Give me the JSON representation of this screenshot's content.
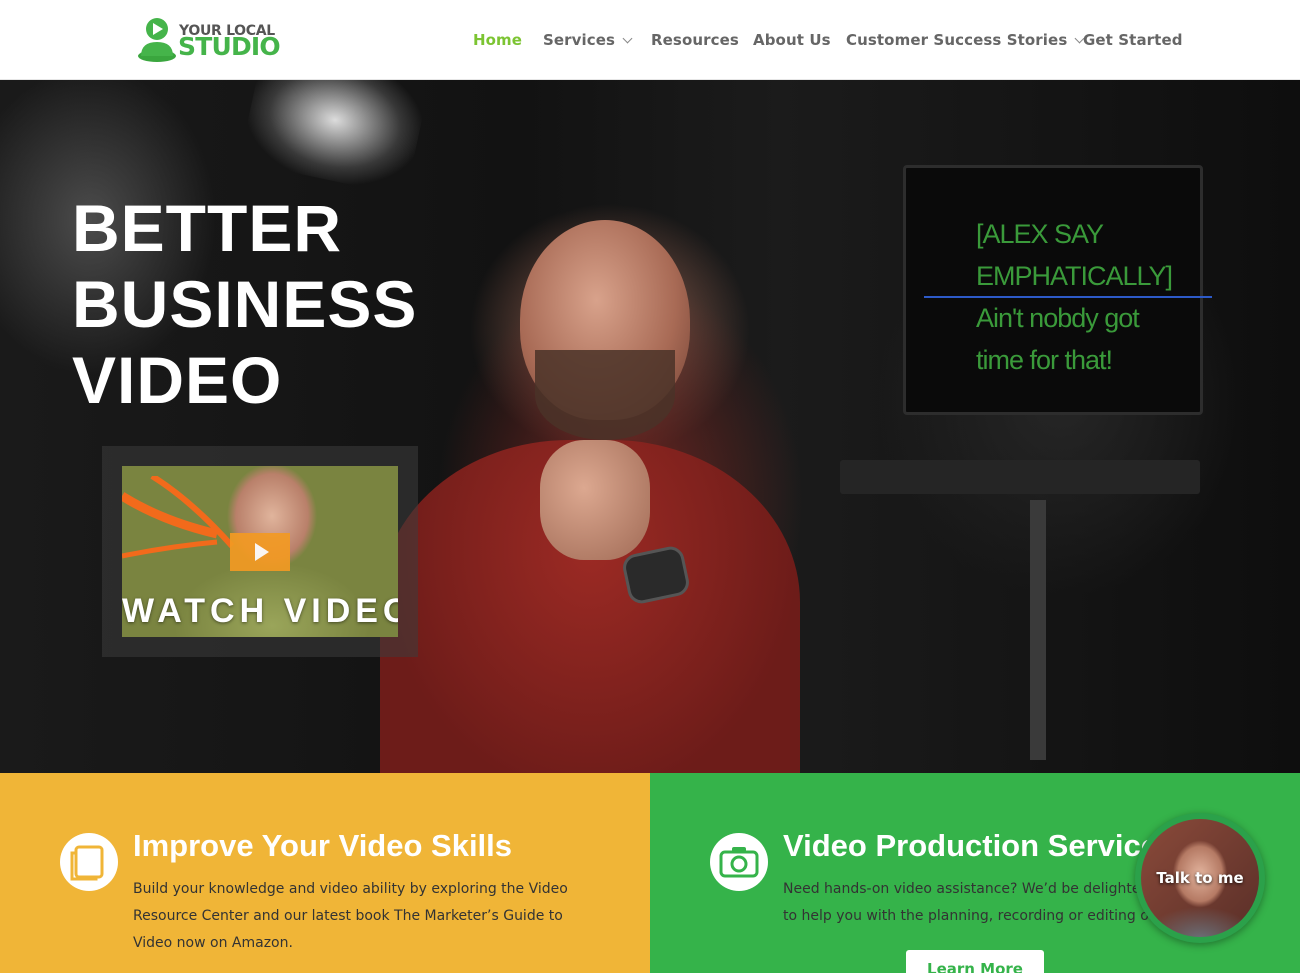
{
  "logo": {
    "line1": "YOUR LOCAL",
    "line2": "STUDIO"
  },
  "nav": {
    "items": [
      {
        "label": "Home",
        "active": true
      },
      {
        "label": "Services",
        "dropdown": true
      },
      {
        "label": "Resources"
      },
      {
        "label": "About Us"
      },
      {
        "label": "Customer Success Stories",
        "dropdown": true
      },
      {
        "label": "Get Started"
      }
    ]
  },
  "hero": {
    "title_line1": "BETTER",
    "title_line2": "BUSINESS",
    "title_line3": "VIDEO",
    "prompter": {
      "line1": "[ALEX SAY",
      "line2": "EMPHATICALLY]",
      "line3": "Ain't nobdy got",
      "line4": "time for that!"
    },
    "video": {
      "label": "WATCH VIDEO"
    }
  },
  "panels": {
    "left": {
      "title": "Improve Your Video Skills",
      "text": "Build your knowledge and video ability by exploring the Video Resource Center and our latest book The Marketer’s Guide to Video now on Amazon.",
      "icon": "book-icon"
    },
    "right": {
      "title": "Video Production Services",
      "text": "Need hands-on video assistance? We’d be delighted to help you with the planning, recording or editing of your business video.",
      "button": "Learn More",
      "icon": "camera-icon"
    }
  },
  "chat": {
    "label": "Talk to me"
  },
  "colors": {
    "brand_green": "#45b44a",
    "nav_active": "#7cc432",
    "panel_yellow": "#f0b537",
    "panel_green": "#35b34a",
    "play_orange": "#f39a23"
  }
}
